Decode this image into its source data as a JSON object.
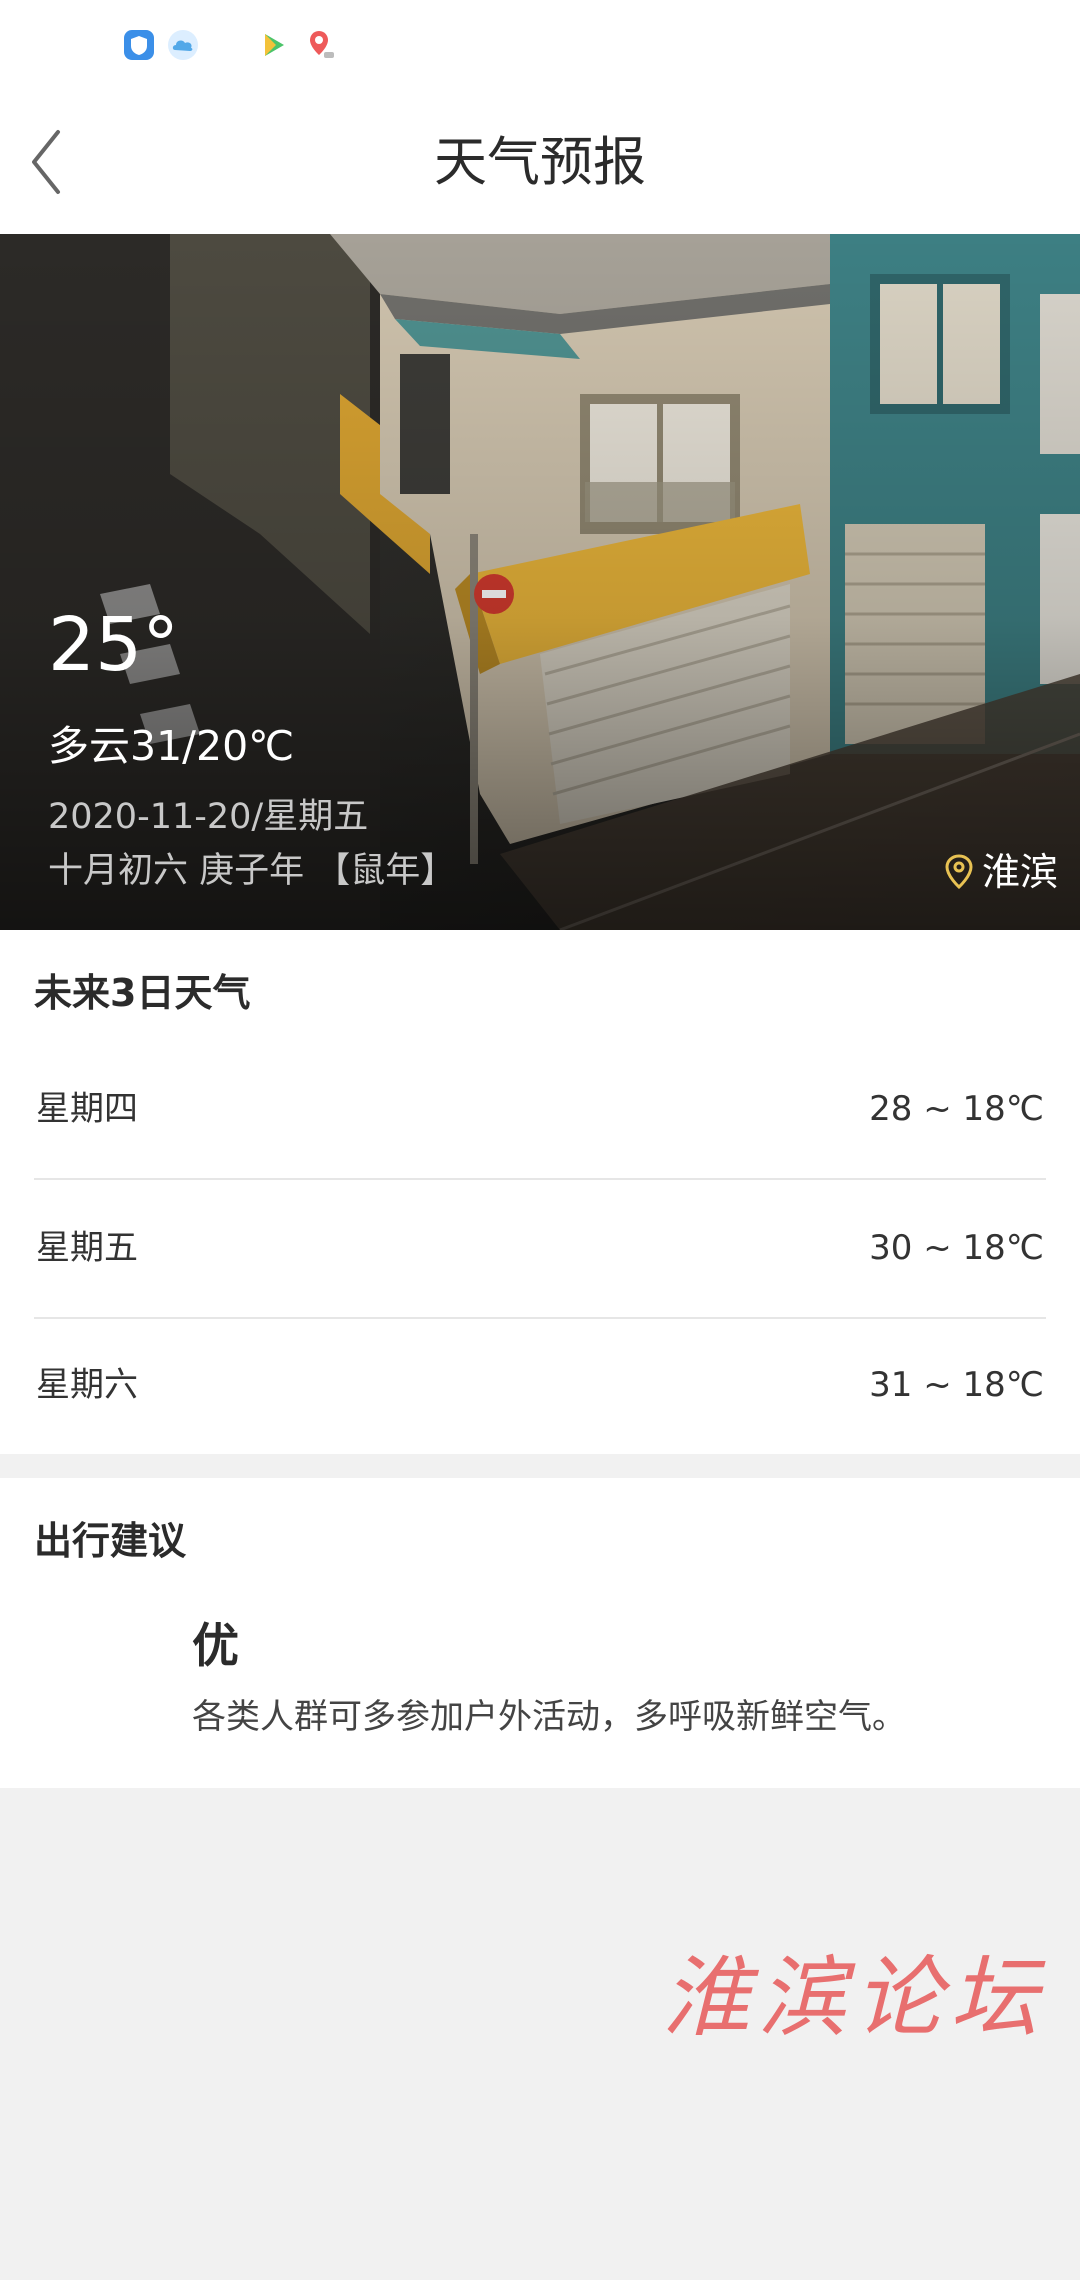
{
  "status_bar": {
    "icons": [
      "shield-icon",
      "cloud-icon",
      "play-icon",
      "map-pin-icon"
    ]
  },
  "header": {
    "title": "天气预报",
    "back_icon": "chevron-left-icon"
  },
  "current": {
    "temperature": "25°",
    "condition": "多云31/20℃",
    "date": "2020-11-20/星期五",
    "lunar": "十月初六 庚子年 【鼠年】",
    "location": "淮滨",
    "location_icon": "location-pin-icon"
  },
  "forecast": {
    "title": "未来3日天气",
    "days": [
      {
        "day": "星期四",
        "range": "28 ~ 18℃"
      },
      {
        "day": "星期五",
        "range": "30 ~ 18℃"
      },
      {
        "day": "星期六",
        "range": "31 ~ 18℃"
      }
    ]
  },
  "travel": {
    "title": "出行建议",
    "level": "优",
    "description": "各类人群可多参加户外活动，多呼吸新鲜空气。"
  },
  "watermark": {
    "text": "淮滨论坛"
  },
  "colors": {
    "background": "#f1f1f1",
    "card": "#ffffff",
    "location_pin": "#e8c253",
    "watermark": "#e86f6f"
  }
}
